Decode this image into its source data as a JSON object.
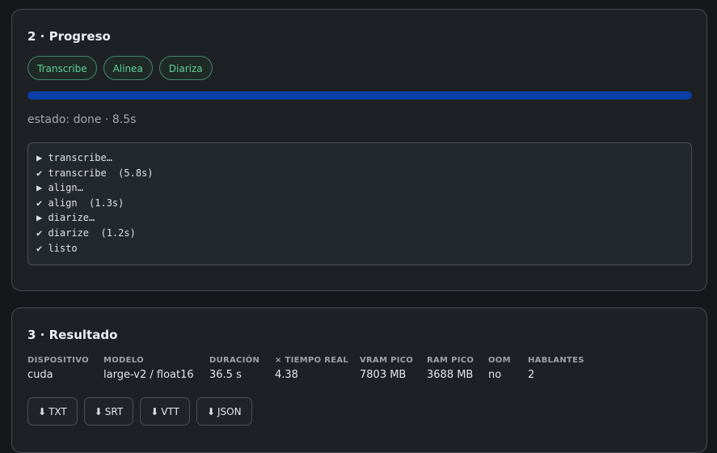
{
  "progress": {
    "title": "2 · Progreso",
    "stages": [
      "Transcribe",
      "Alinea",
      "Diariza"
    ],
    "bar_fraction": 1.0,
    "bar_color": "#0a3fa8",
    "status": "estado: done · 8.5s",
    "log": [
      "▶ transcribe…",
      "✔ transcribe  (5.8s)",
      "▶ align…",
      "✔ align  (1.3s)",
      "▶ diarize…",
      "✔ diarize  (1.2s)",
      "✔ listo"
    ]
  },
  "result": {
    "title": "3 · Resultado",
    "metrics": [
      {
        "label": "DISPOSITIVO",
        "value": "cuda"
      },
      {
        "label": "MODELO",
        "value": "large-v2 / float16"
      },
      {
        "label": "DURACIÓN",
        "value": "36.5 s"
      },
      {
        "label": "× TIEMPO REAL",
        "value": "4.38"
      },
      {
        "label": "VRAM PICO",
        "value": "7803 MB"
      },
      {
        "label": "RAM PICO",
        "value": "3688 MB"
      },
      {
        "label": "OOM",
        "value": "no"
      },
      {
        "label": "HABLANTES",
        "value": "2"
      }
    ],
    "downloads": [
      {
        "icon": "download-icon",
        "label": "TXT"
      },
      {
        "icon": "download-icon",
        "label": "SRT"
      },
      {
        "icon": "download-icon",
        "label": "VTT"
      },
      {
        "icon": "download-icon",
        "label": "JSON"
      }
    ]
  }
}
